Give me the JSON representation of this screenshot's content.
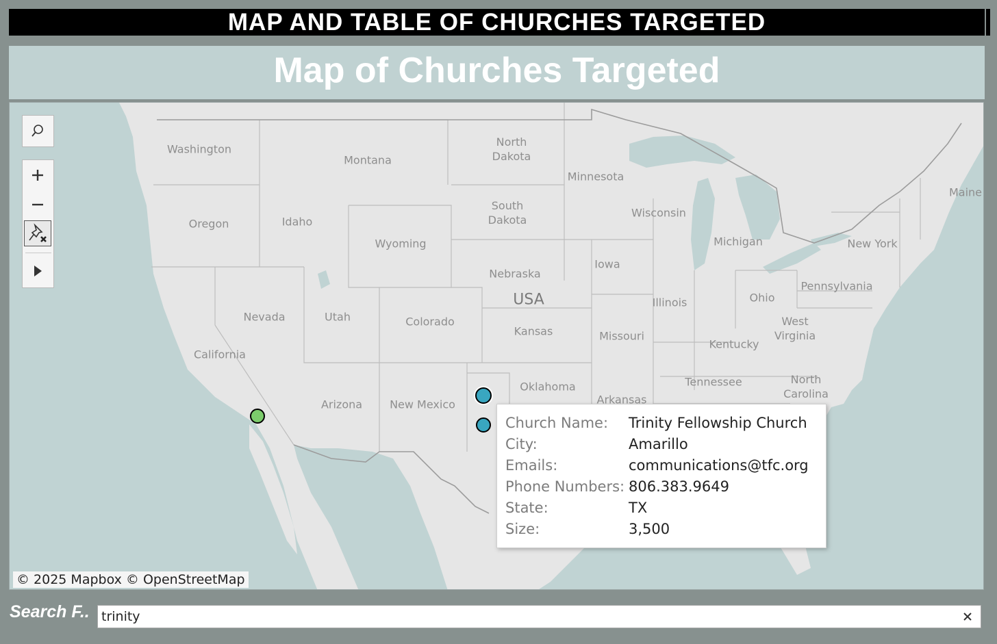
{
  "header": {
    "banner_title": "MAP AND TABLE OF CHURCHES TARGETED"
  },
  "map": {
    "title": "Map of Churches Targeted",
    "attribution": "© 2025 Mapbox © OpenStreetMap",
    "labels": {
      "washington": "Washington",
      "montana": "Montana",
      "north_dakota": "North\nDakota",
      "minnesota": "Minnesota",
      "maine": "Maine",
      "oregon": "Oregon",
      "idaho": "Idaho",
      "south_dakota": "South\nDakota",
      "wisconsin": "Wisconsin",
      "michigan": "Michigan",
      "new_york": "New York",
      "wyoming": "Wyoming",
      "nebraska": "Nebraska",
      "iowa": "Iowa",
      "pennsylvania": "Pennsylvania",
      "usa": "USA",
      "nevada": "Nevada",
      "utah": "Utah",
      "colorado": "Colorado",
      "illinois": "Illinois",
      "ohio": "Ohio",
      "kansas": "Kansas",
      "missouri": "Missouri",
      "west_virginia": "West\nVirginia",
      "kentucky": "Kentucky",
      "california": "California",
      "tennessee": "Tennessee",
      "north_carolina": "North\nCarolina",
      "oklahoma": "Oklahoma",
      "arkansas": "Arkansas",
      "arizona": "Arizona",
      "new_mexico": "New Mexico"
    },
    "markers": [
      {
        "name": "california-marker",
        "color": "#7ccc6c"
      },
      {
        "name": "amarillo-marker",
        "color": "#39a6c0"
      },
      {
        "name": "texas-marker",
        "color": "#39a6c0"
      }
    ]
  },
  "tooltip": {
    "rows": [
      {
        "label": "Church Name:",
        "value": "Trinity Fellowship Church"
      },
      {
        "label": "City:",
        "value": "Amarillo"
      },
      {
        "label": "Emails:",
        "value": "communications@tfc.org"
      },
      {
        "label": "Phone Numbers:",
        "value": "806.383.9649"
      },
      {
        "label": "State:",
        "value": "TX"
      },
      {
        "label": "Size:",
        "value": "3,500"
      }
    ]
  },
  "search": {
    "label": "Search F..",
    "value": "trinity"
  },
  "icons": {
    "search": "search-icon",
    "zoom_in": "plus-icon",
    "zoom_out": "minus-icon",
    "unpin": "pin-clear-icon",
    "expand": "play-icon",
    "clear": "close-icon"
  },
  "colors": {
    "page_bg": "#87918f",
    "water": "#c0d3d3",
    "land": "#e6e6e6",
    "title_bar": "#c0d2d2",
    "marker_green": "#7ccc6c",
    "marker_blue": "#39a6c0"
  }
}
